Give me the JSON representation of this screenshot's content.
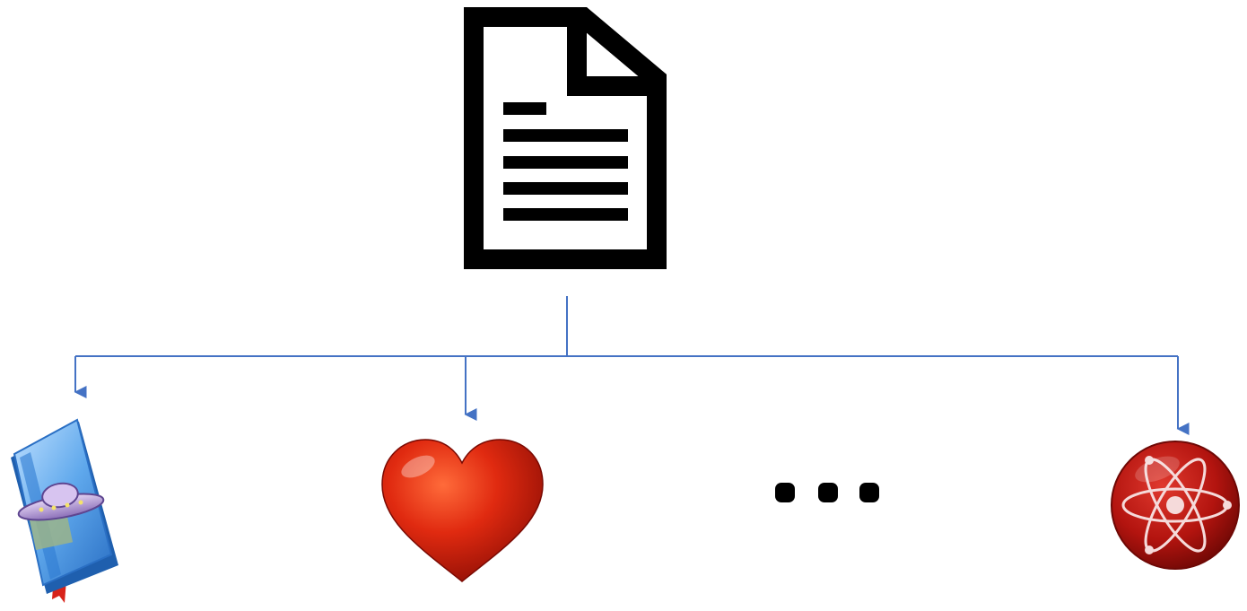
{
  "diagram": {
    "root": {
      "icon": "document-icon"
    },
    "children": [
      {
        "icon": "sci-fi-book-icon"
      },
      {
        "icon": "heart-icon"
      },
      {
        "icon": "ellipsis-icon"
      },
      {
        "icon": "atom-icon"
      }
    ],
    "colors": {
      "connector": "#4472C4",
      "document_stroke": "#000000",
      "heart": "#D8200E",
      "atom": "#B3140F",
      "book": "#4A9BE0"
    }
  }
}
